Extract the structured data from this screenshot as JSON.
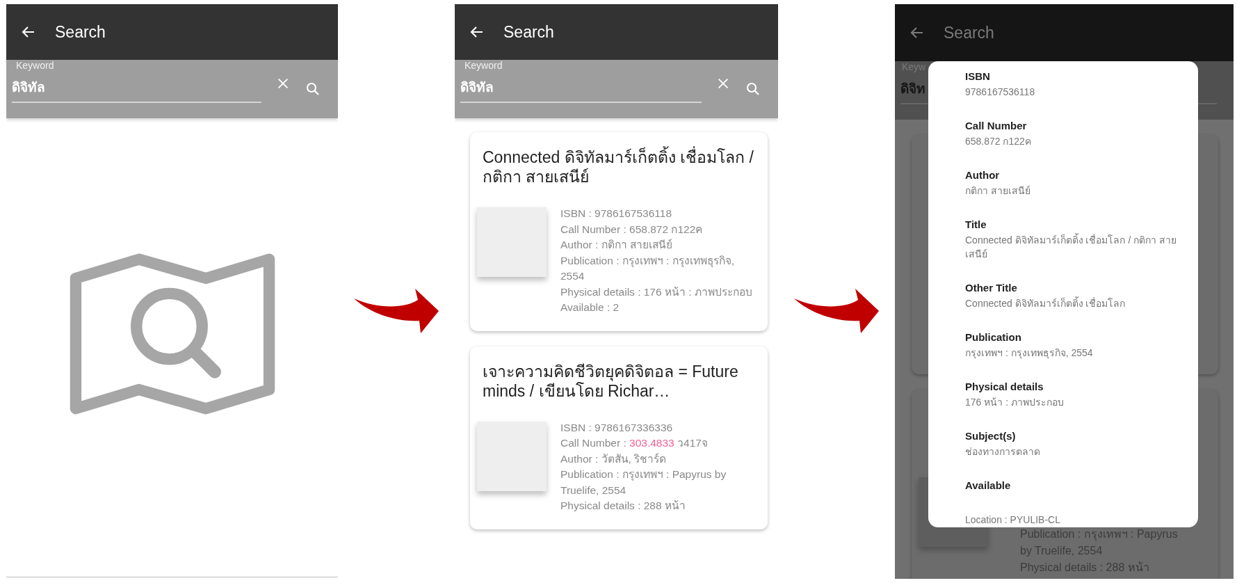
{
  "panels": [
    {
      "kind": "empty",
      "app_bar": {
        "title": "Search"
      },
      "search": {
        "label": "Keyword",
        "value": "ดิจิทัล"
      }
    },
    {
      "kind": "results",
      "app_bar": {
        "title": "Search"
      },
      "search": {
        "label": "Keyword",
        "value": "ดิจิทัล"
      },
      "results": [
        {
          "title": "Connected ดิจิทัลมาร์เก็ตติ้ง เชื่อมโลก / กติกา สายเสนีย์",
          "details": [
            {
              "text": "ISBN : 9786167536118"
            },
            {
              "text": "Call Number : 658.872 ก122ค"
            },
            {
              "text": "Author : กติกา สายเสนีย์"
            },
            {
              "text": "Publication : กรุงเทพฯ : กรุงเทพธุรกิจ, 2554"
            },
            {
              "text": "Physical details : 176 หน้า : ภาพประกอบ"
            },
            {
              "text": "Available : 2"
            }
          ]
        },
        {
          "title": "เจาะความคิดชีวิตยุคดิจิตอล = Future minds / เขียนโดย Richar…",
          "details": [
            {
              "text": "ISBN : 9786167336336"
            },
            {
              "parts": [
                {
                  "text": "Call Number : ",
                  "highlighted": false
                },
                {
                  "text": "303.4833",
                  "highlighted": true
                },
                {
                  "text": " ว417จ",
                  "highlighted": false
                }
              ]
            },
            {
              "text": "Author : วัตสัน, ริชาร์ด"
            },
            {
              "text": "Publication : กรุงเทพฯ : Papyrus by Truelife, 2554"
            },
            {
              "text": "Physical details : 288 หน้า"
            }
          ]
        }
      ]
    },
    {
      "kind": "detail",
      "app_bar": {
        "title": "Search"
      },
      "search": {
        "label": "Keyw",
        "value": "ดิจิท"
      },
      "background_lines": [
        "Publication : กรุงเทพฯ : Papyrus",
        "by Truelife, 2554",
        "Physical details : 288 หน้า"
      ],
      "dialog": {
        "fields": [
          {
            "label": "ISBN",
            "value": "9786167536118"
          },
          {
            "label": "Call Number",
            "value": "658.872 ก122ค"
          },
          {
            "label": "Author",
            "value": "กติกา สายเสนีย์"
          },
          {
            "label": "Title",
            "value": "Connected ดิจิทัลมาร์เก็ตติ้ง เชื่อมโลก / กติกา สายเสนีย์"
          },
          {
            "label": "Other Title",
            "value": "Connected ดิจิทัลมาร์เก็ตติ้ง เชื่อมโลก"
          },
          {
            "label": "Publication",
            "value": "กรุงเทพฯ : กรุงเทพธุรกิจ, 2554"
          },
          {
            "label": "Physical details",
            "value": "176 หน้า : ภาพประกอบ"
          },
          {
            "label": "Subject(s)",
            "value": "ช่องทางการตลาด"
          },
          {
            "label": "Available"
          }
        ],
        "location": "Location : PYULIB-CL"
      }
    }
  ]
}
